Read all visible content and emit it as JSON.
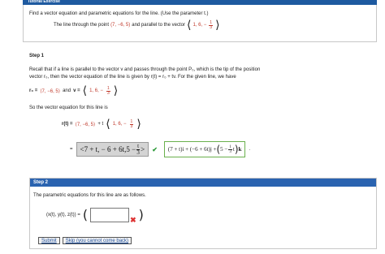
{
  "header": {
    "title": "Tutorial Exercise"
  },
  "problem": {
    "prompt": "Find a vector equation and parametric equations for the line. (Use the parameter t.)",
    "line_text": "The line through the point",
    "point": "(7, −6, 5)",
    "parallel_text": "and parallel to the vector",
    "vector_main": "1, 6, −",
    "vector_num": "1",
    "vector_den": "3"
  },
  "step1": {
    "label": "Step 1",
    "para1": "Recall that if a line is parallel to the vector v and passes through the point P₀, which is the tip of the position",
    "para2": "vector r₀, then the vector equation of the line is given by r(t) = r₀ + tv. For the given line, we have",
    "r0_label": "r₀ =",
    "r0_value": "⟨7, −6, 5⟩",
    "and_text": "and",
    "v_label": "v =",
    "v_main": "1, 6, −",
    "v_num": "1",
    "v_den": "3",
    "so_text": "So the vector equation for this line is",
    "rt_label": "r(t) =",
    "rt_point": "⟨7, −6, 5⟩",
    "rt_plus": "+ t",
    "rt_vec_main": "1, 6, −",
    "rt_vec_num": "1",
    "rt_vec_den": "3",
    "eq_sign": "=",
    "answer_main": "<7 + t, − 6 + 6t,5 −",
    "answer_num": "t",
    "answer_den": "3",
    "answer_close": ">",
    "check": "✔",
    "expanded_1": "(7 + t)i + (−6 + 6t)j +",
    "expanded_2": "5 −",
    "expanded_num": "1",
    "expanded_den": "3",
    "expanded_3": "t",
    "expanded_4": "k",
    "period": "."
  },
  "step2": {
    "label": "Step 2",
    "text": "The parametric equations for this line are as follows.",
    "xyz_label": "(x(t), y(t), z(t)) =",
    "x_mark": "✖",
    "submit": "Submit",
    "skip": "Skip (you cannot come back)"
  }
}
